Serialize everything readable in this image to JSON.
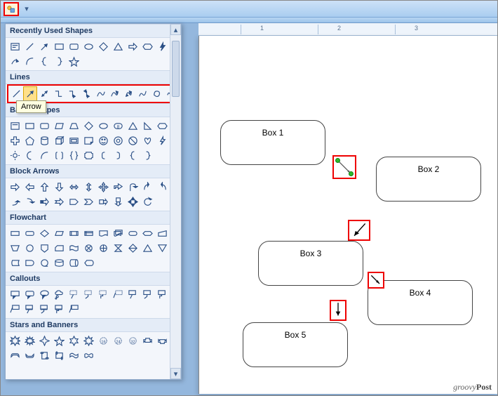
{
  "tooltip": "Arrow",
  "ruler_numbers": [
    "1",
    "2",
    "3"
  ],
  "categories": {
    "recent": "Recently Used Shapes",
    "lines": "Lines",
    "basic": "Basic Shapes",
    "block": "Block Arrows",
    "flow": "Flowchart",
    "callouts": "Callouts",
    "stars": "Stars and Banners"
  },
  "boxes": {
    "b1": "Box 1",
    "b2": "Box 2",
    "b3": "Box 3",
    "b4": "Box 4",
    "b5": "Box 5"
  },
  "watermark_prefix": "groovy",
  "watermark_suffix": "Post"
}
